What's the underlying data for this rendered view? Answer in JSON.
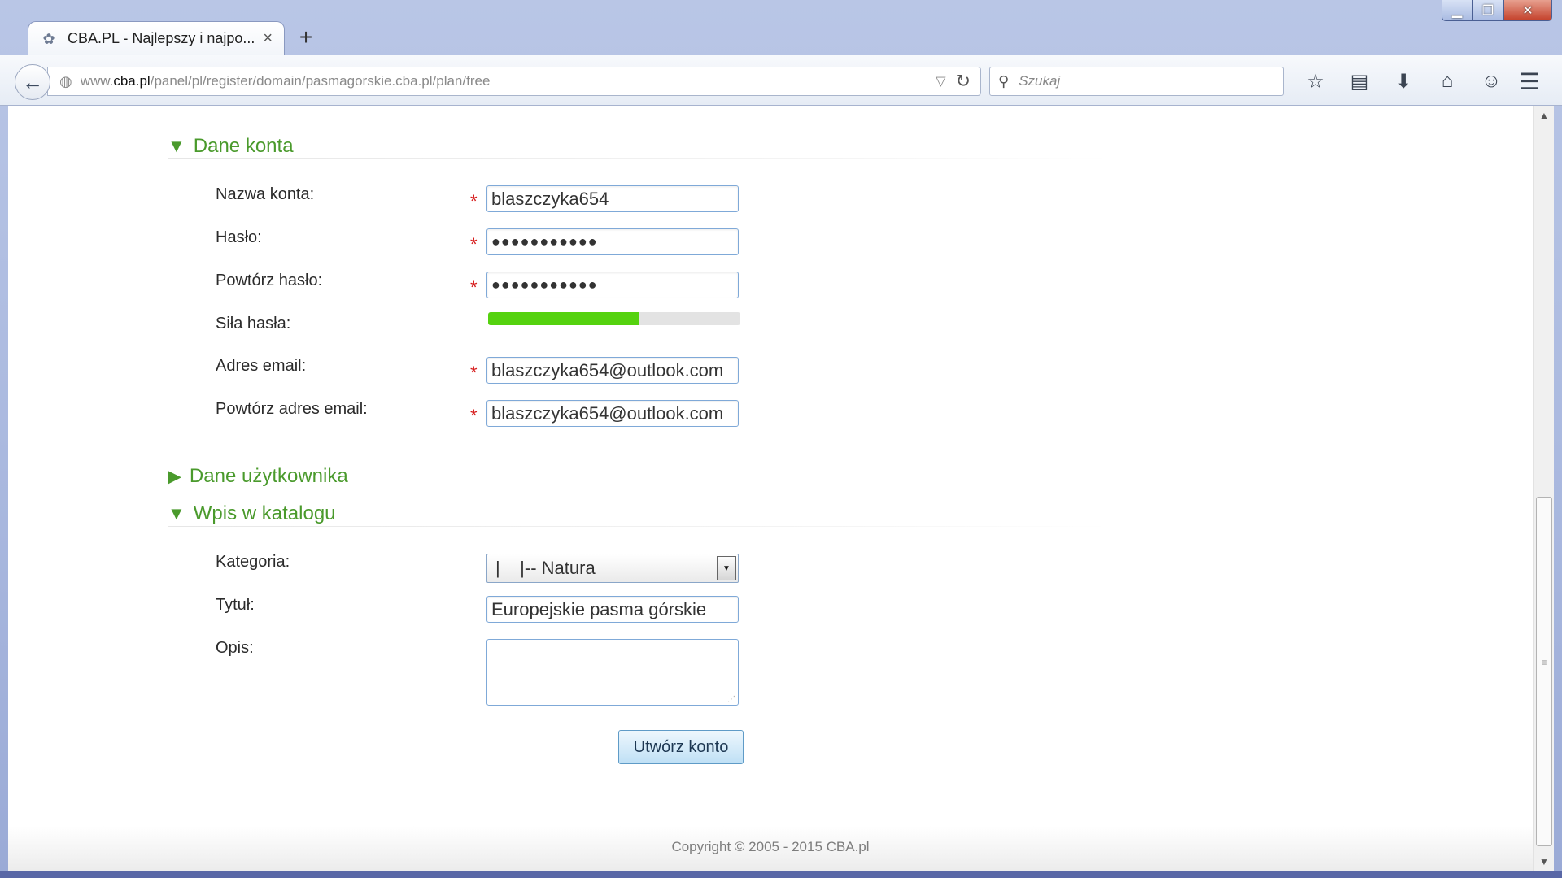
{
  "window": {
    "minimize": "▁",
    "maximize": "❐",
    "close": "✕"
  },
  "tabs": [
    {
      "title": "CBA.PL - Najlepszy i najpo...",
      "close": "×"
    }
  ],
  "new_tab": "+",
  "toolbar": {
    "back": "←",
    "url_prefix": "www.",
    "url_domain": "cba.pl",
    "url_path": "/panel/pl/register/domain/pasmagorskie.cba.pl/plan/free",
    "url_dropdown": "▽",
    "reload": "↻",
    "search_placeholder": "Szukaj",
    "icons": [
      "☆",
      "▤",
      "⬇",
      "⌂",
      "☺"
    ],
    "menu": "☰"
  },
  "sections": {
    "account": {
      "title": "Dane konta",
      "expanded_marker": "▼"
    },
    "user": {
      "title": "Dane użytkownika",
      "collapsed_marker": "▶"
    },
    "catalog": {
      "title": "Wpis w katalogu",
      "expanded_marker": "▼"
    }
  },
  "form": {
    "required_marker": "*",
    "account_name": {
      "label": "Nazwa konta:",
      "value": "blaszczyka654"
    },
    "password": {
      "label": "Hasło:",
      "value": "●●●●●●●●●●●"
    },
    "password_repeat": {
      "label": "Powtórz hasło:",
      "value": "●●●●●●●●●●●"
    },
    "password_strength": {
      "label": "Siła hasła:",
      "level": 0.6
    },
    "email": {
      "label": "Adres email:",
      "value": "blaszczyka654@outlook.com"
    },
    "email_repeat": {
      "label": "Powtórz adres email:",
      "value": "blaszczyka654@outlook.com"
    },
    "category": {
      "label": "Kategoria:",
      "selected": "|    |-- Natura"
    },
    "title": {
      "label": "Tytuł:",
      "value": "Europejskie pasma górskie"
    },
    "description": {
      "label": "Opis:",
      "value": ""
    },
    "submit_label": "Utwórz konto"
  },
  "footer": {
    "copyright": "Copyright © 2005 - 2015 CBA.pl"
  },
  "colors": {
    "section_green": "#4a9a2c",
    "required_red": "#d61b1b",
    "strength_fill": "#55d20f",
    "input_border": "#7fa9d8"
  }
}
